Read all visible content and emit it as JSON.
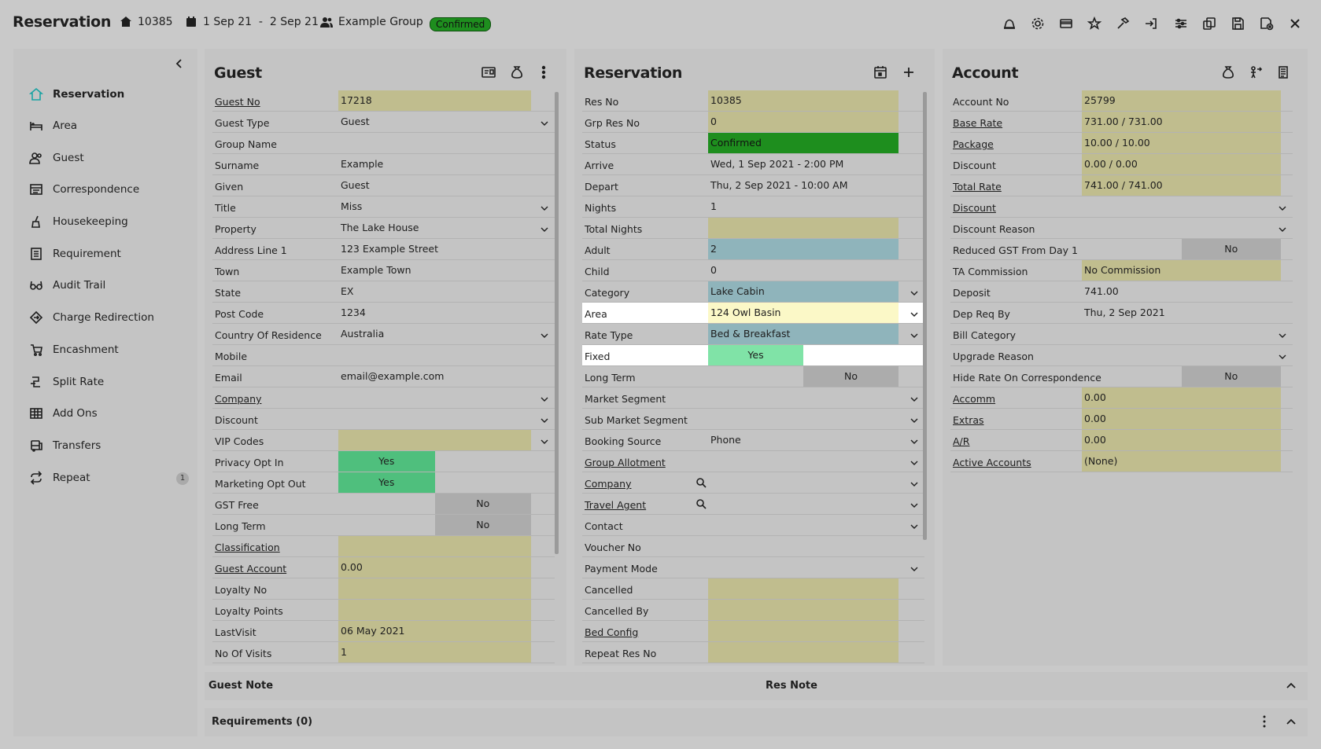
{
  "header": {
    "title": "Reservation",
    "res_no": "10385",
    "dates": "1 Sep 21  -  2 Sep 21",
    "group": "Example Group",
    "status": "Confirmed"
  },
  "sidebar": {
    "items": [
      {
        "label": "Reservation",
        "icon": "home-icon"
      },
      {
        "label": "Area",
        "icon": "bed-icon"
      },
      {
        "label": "Guest",
        "icon": "people-icon"
      },
      {
        "label": "Correspondence",
        "icon": "correspondence-icon"
      },
      {
        "label": "Housekeeping",
        "icon": "broom-icon"
      },
      {
        "label": "Requirement",
        "icon": "checklist-icon"
      },
      {
        "label": "Audit Trail",
        "icon": "glasses-icon"
      },
      {
        "label": "Charge Redirection",
        "icon": "diamond-arrow-icon"
      },
      {
        "label": "Encashment",
        "icon": "cart-icon"
      },
      {
        "label": "Split Rate",
        "icon": "split-icon"
      },
      {
        "label": "Add Ons",
        "icon": "grid-icon"
      },
      {
        "label": "Transfers",
        "icon": "bus-icon"
      },
      {
        "label": "Repeat",
        "icon": "repeat-icon",
        "badge": "1"
      }
    ]
  },
  "guest": {
    "title": "Guest",
    "rows": [
      {
        "label": "Guest No",
        "value": "17218"
      },
      {
        "label": "Guest Type",
        "value": "Guest"
      },
      {
        "label": "Group Name",
        "value": ""
      },
      {
        "label": "Surname",
        "value": "Example"
      },
      {
        "label": "Given",
        "value": "Guest"
      },
      {
        "label": "Title",
        "value": "Miss"
      },
      {
        "label": "Property",
        "value": "The Lake House"
      },
      {
        "label": "Address Line 1",
        "value": "123 Example Street"
      },
      {
        "label": "Town",
        "value": "Example Town"
      },
      {
        "label": "State",
        "value": "EX"
      },
      {
        "label": "Post Code",
        "value": "1234"
      },
      {
        "label": "Country Of Residence",
        "value": "Australia"
      },
      {
        "label": "Mobile",
        "value": ""
      },
      {
        "label": "Email",
        "value": "email@example.com"
      },
      {
        "label": "Company",
        "value": ""
      },
      {
        "label": "Discount",
        "value": ""
      },
      {
        "label": "VIP Codes",
        "value": ""
      },
      {
        "label": "Privacy Opt In",
        "value": "Yes"
      },
      {
        "label": "Marketing Opt Out",
        "value": "Yes"
      },
      {
        "label": "GST Free",
        "value": "No"
      },
      {
        "label": "Long Term",
        "value": "No"
      },
      {
        "label": "Classification",
        "value": ""
      },
      {
        "label": "Guest Account",
        "value": "0.00"
      },
      {
        "label": "Loyalty No",
        "value": ""
      },
      {
        "label": "Loyalty Points",
        "value": ""
      },
      {
        "label": "LastVisit",
        "value": "06 May 2021"
      },
      {
        "label": "No Of Visits",
        "value": "1"
      }
    ]
  },
  "reservation": {
    "title": "Reservation",
    "rows": [
      {
        "label": "Res No",
        "value": "10385"
      },
      {
        "label": "Grp Res No",
        "value": "0"
      },
      {
        "label": "Status",
        "value": "Confirmed"
      },
      {
        "label": "Arrive",
        "value": "Wed, 1 Sep 2021 - 2:00 PM"
      },
      {
        "label": "Depart",
        "value": "Thu, 2 Sep 2021 - 10:00 AM"
      },
      {
        "label": "Nights",
        "value": "1"
      },
      {
        "label": "Total Nights",
        "value": ""
      },
      {
        "label": "Adult",
        "value": "2"
      },
      {
        "label": "Child",
        "value": "0"
      },
      {
        "label": "Category",
        "value": "Lake Cabin"
      },
      {
        "label": "Area",
        "value": "124 Owl Basin"
      },
      {
        "label": "Rate Type",
        "value": "Bed & Breakfast"
      },
      {
        "label": "Fixed",
        "value": "Yes"
      },
      {
        "label": "Long Term",
        "value": "No"
      },
      {
        "label": "Market Segment",
        "value": ""
      },
      {
        "label": "Sub Market Segment",
        "value": ""
      },
      {
        "label": "Booking Source",
        "value": "Phone"
      },
      {
        "label": "Group Allotment",
        "value": ""
      },
      {
        "label": "Company",
        "value": ""
      },
      {
        "label": "Travel Agent",
        "value": ""
      },
      {
        "label": "Contact",
        "value": ""
      },
      {
        "label": "Voucher No",
        "value": ""
      },
      {
        "label": "Payment Mode",
        "value": ""
      },
      {
        "label": "Cancelled",
        "value": ""
      },
      {
        "label": "Cancelled By",
        "value": ""
      },
      {
        "label": "Bed Config",
        "value": ""
      },
      {
        "label": "Repeat Res No",
        "value": ""
      }
    ]
  },
  "account": {
    "title": "Account",
    "rows": [
      {
        "label": "Account No",
        "value": "25799"
      },
      {
        "label": "Base Rate",
        "value": "731.00 / 731.00"
      },
      {
        "label": "Package",
        "value": "10.00 / 10.00"
      },
      {
        "label": "Discount",
        "value": "0.00 / 0.00"
      },
      {
        "label": "Total Rate",
        "value": "741.00 / 741.00"
      },
      {
        "label": "Discount",
        "value": ""
      },
      {
        "label": "Discount Reason",
        "value": ""
      },
      {
        "label": "Reduced GST From Day 1",
        "value": "No"
      },
      {
        "label": "TA Commission",
        "value": "No Commission"
      },
      {
        "label": "Deposit",
        "value": "741.00"
      },
      {
        "label": "Dep Req By",
        "value": "Thu, 2 Sep 2021"
      },
      {
        "label": "Bill Category",
        "value": ""
      },
      {
        "label": "Upgrade Reason",
        "value": ""
      },
      {
        "label": "Hide Rate On Correspondence",
        "value": "No"
      },
      {
        "label": "Accomm",
        "value": "0.00"
      },
      {
        "label": "Extras",
        "value": "0.00"
      },
      {
        "label": "A/R",
        "value": "0.00"
      },
      {
        "label": "Active Accounts",
        "value": "(None)"
      }
    ]
  },
  "bottom": {
    "guest_note": "Guest Note",
    "res_note": "Res Note",
    "requirements": "Requirements (0)"
  }
}
